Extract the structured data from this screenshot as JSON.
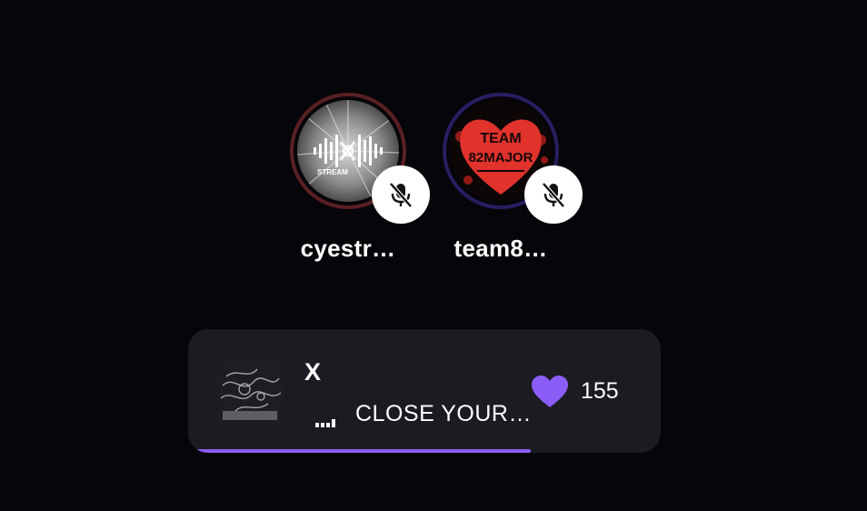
{
  "participants": [
    {
      "name": "cyestr…",
      "muted": true,
      "ring_color": "#5a2023",
      "avatar_icon": "stream-logo-avatar"
    },
    {
      "name": "team8…",
      "muted": true,
      "ring_color": "#2b1d63",
      "avatar_icon": "team-heart-avatar"
    }
  ],
  "avatar_text": {
    "p1": {
      "line1": "STREAM"
    },
    "p2": {
      "line1": "TEAM",
      "line2": "82MAJOR"
    }
  },
  "now_playing": {
    "title": "X",
    "artist": "CLOSE YOUR…",
    "likes": "155",
    "progress": 0.72,
    "accent_color": "#8b5cf6",
    "like_icon": "heart-icon",
    "playing_icon": "equalizer-icon"
  }
}
